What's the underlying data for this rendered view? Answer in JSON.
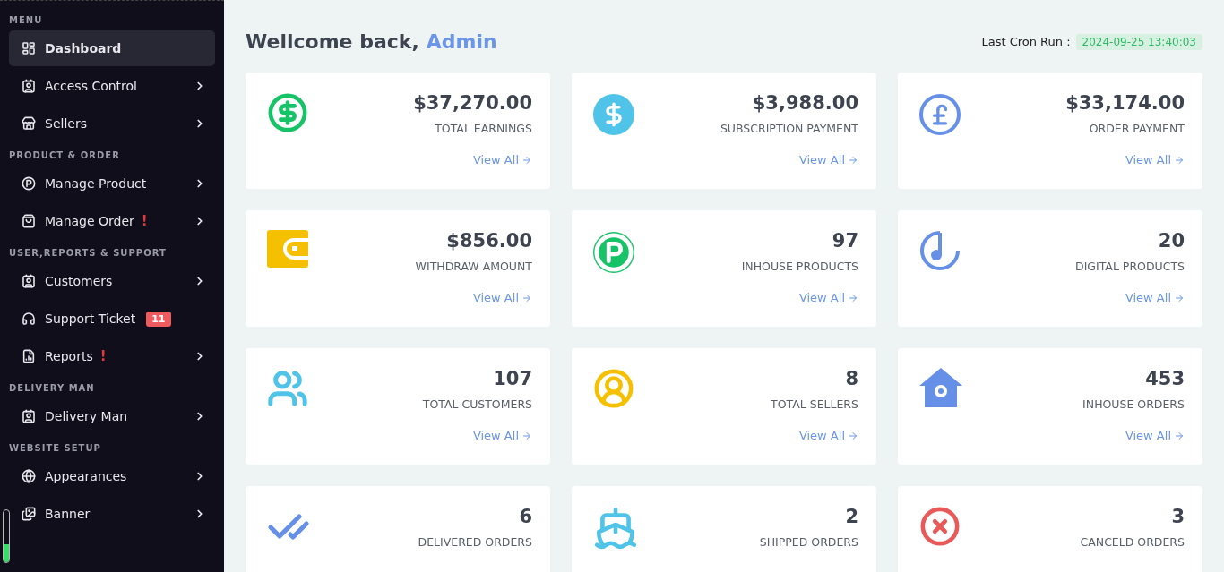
{
  "sidebar": {
    "sections": [
      {
        "title": "MENU",
        "items": [
          {
            "label": "Dashboard",
            "kind": "dashboard",
            "selected": true,
            "chevron": false
          },
          {
            "label": "Access Control",
            "kind": "contact",
            "selected": false,
            "chevron": true
          },
          {
            "label": "Sellers",
            "kind": "store",
            "selected": false,
            "chevron": true
          }
        ]
      },
      {
        "title": "PRODUCT & ORDER",
        "items": [
          {
            "label": "Manage Product",
            "kind": "parking",
            "selected": false,
            "chevron": true
          },
          {
            "label": "Manage Order",
            "kind": "bag",
            "selected": false,
            "chevron": true,
            "alert": "!"
          }
        ]
      },
      {
        "title": "USER,REPORTS & SUPPORT",
        "items": [
          {
            "label": "Customers",
            "kind": "contact",
            "selected": false,
            "chevron": true
          },
          {
            "label": "Support Ticket",
            "kind": "headset",
            "selected": false,
            "chevron": false,
            "badge": "11"
          },
          {
            "label": "Reports",
            "kind": "report",
            "selected": false,
            "chevron": true,
            "alert": "!"
          }
        ]
      },
      {
        "title": "DELIVERY MAN",
        "items": [
          {
            "label": "Delivery Man",
            "kind": "contact",
            "selected": false,
            "chevron": true
          }
        ]
      },
      {
        "title": "WEBSITE SETUP",
        "items": [
          {
            "label": "Appearances",
            "kind": "globe",
            "selected": false,
            "chevron": true
          },
          {
            "label": "Banner",
            "kind": "images",
            "selected": false,
            "chevron": true
          }
        ]
      }
    ]
  },
  "header": {
    "greeting": "Wellcome back,",
    "user": "Admin",
    "cron_label": "Last Cron Run :",
    "cron_time": "2024-09-25 13:40:03"
  },
  "cards": [
    {
      "value": "$37,270.00",
      "label": "TOTAL EARNINGS",
      "link": "View All",
      "kind": "dollar-outline",
      "color": "#16c467"
    },
    {
      "value": "$3,988.00",
      "label": "SUBSCRIPTION PAYMENT",
      "link": "View All",
      "kind": "dollar-filled",
      "color": "#4fc3e8"
    },
    {
      "value": "$33,174.00",
      "label": "ORDER PAYMENT",
      "link": "View All",
      "kind": "pound",
      "color": "#6690e8"
    },
    {
      "value": "$856.00",
      "label": "WITHDRAW AMOUNT",
      "link": "View All",
      "kind": "wallet",
      "color": "#f5c000"
    },
    {
      "value": "97",
      "label": "INHOUSE PRODUCTS",
      "link": "View All",
      "kind": "parking",
      "color": "#16c467"
    },
    {
      "value": "20",
      "label": "DIGITAL PRODUCTS",
      "link": "View All",
      "kind": "music",
      "color": "#6690e8"
    },
    {
      "value": "107",
      "label": "TOTAL CUSTOMERS",
      "link": "View All",
      "kind": "users",
      "color": "#4fc3e8"
    },
    {
      "value": "8",
      "label": "TOTAL SELLERS",
      "link": "View All",
      "kind": "user-circle",
      "color": "#f5c000"
    },
    {
      "value": "453",
      "label": "INHOUSE ORDERS",
      "link": "View All",
      "kind": "house-gear",
      "color": "#6690e8"
    },
    {
      "value": "6",
      "label": "DELIVERED ORDERS",
      "kind": "double-check",
      "color": "#6690e8"
    },
    {
      "value": "2",
      "label": "SHIPPED ORDERS",
      "kind": "ship",
      "color": "#4fc3e8"
    },
    {
      "value": "3",
      "label": "CANCELD ORDERS",
      "kind": "x-circle",
      "color": "#e85a5a"
    }
  ]
}
